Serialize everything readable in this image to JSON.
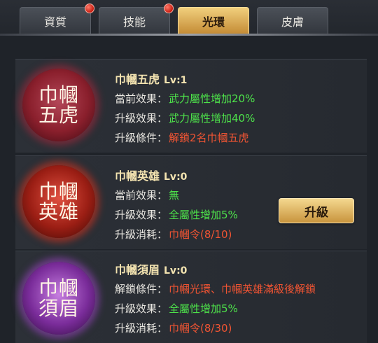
{
  "tabs": [
    {
      "label": "資質",
      "active": false,
      "badge": true
    },
    {
      "label": "技能",
      "active": false,
      "badge": true
    },
    {
      "label": "光環",
      "active": true,
      "badge": false
    },
    {
      "label": "皮膚",
      "active": false,
      "badge": false
    }
  ],
  "auras": [
    {
      "emblem": "巾幗五虎",
      "name": "巾幗五虎",
      "level": "Lv:1",
      "rows": [
        {
          "label": "當前效果：",
          "value": "武力屬性增加20%",
          "color": "green"
        },
        {
          "label": "升級效果：",
          "value": "武力屬性增加40%",
          "color": "green"
        },
        {
          "label": "升級條件：",
          "value": "解鎖2名巾幗五虎",
          "color": "red"
        }
      ]
    },
    {
      "emblem": "巾幗英雄",
      "name": "巾幗英雄",
      "level": "Lv:0",
      "rows": [
        {
          "label": "當前效果：",
          "value": "無",
          "color": "green"
        },
        {
          "label": "升級效果：",
          "value": "全屬性增加5%",
          "color": "green"
        },
        {
          "label": "升級消耗：",
          "value": "巾幗令(8/10)",
          "color": "red"
        }
      ],
      "button": "升級"
    },
    {
      "emblem": "巾幗須眉",
      "name": "巾幗須眉",
      "level": "Lv:0",
      "rows": [
        {
          "label": "解鎖條件：",
          "value": "巾幗光環、巾幗英雄滿級後解鎖",
          "color": "red"
        },
        {
          "label": "升級效果：",
          "value": "全屬性增加5%",
          "color": "green"
        },
        {
          "label": "升級消耗：",
          "value": "巾幗令(8/30)",
          "color": "red"
        }
      ]
    }
  ],
  "colors": {
    "accent": "#d9a94c",
    "green": "#4de14a",
    "red": "#ef5433"
  }
}
